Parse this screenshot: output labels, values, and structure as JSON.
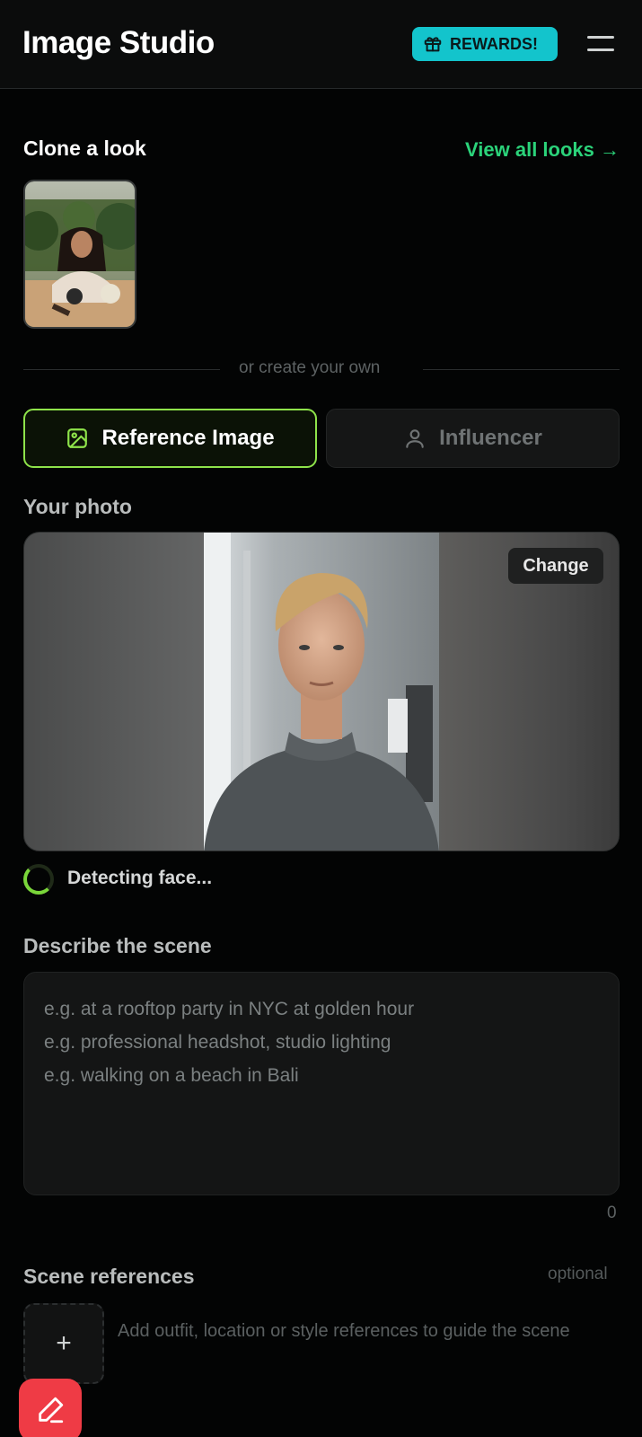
{
  "header": {
    "title": "Image Studio",
    "rewards_label": "REWARDS!",
    "accent": "#13c4cc"
  },
  "clone": {
    "title": "Clone a look",
    "view_all": "View all looks →",
    "link_color": "#2bd37a"
  },
  "divider": {
    "text": "or create your own"
  },
  "tabs": [
    {
      "label": "Reference Image",
      "icon": "image-icon",
      "active": true
    },
    {
      "label": "Influencer",
      "icon": "user-icon",
      "active": false
    }
  ],
  "photo": {
    "label": "Your photo",
    "change_label": "Change",
    "status": "Detecting face..."
  },
  "scene": {
    "label": "Describe the scene",
    "placeholder_lines": [
      "e.g. at a rooftop party in NYC at golden hour",
      "e.g. professional headshot, studio lighting",
      "e.g. walking on a beach in Bali"
    ],
    "char_count": "0"
  },
  "references": {
    "label": "Scene references",
    "optional": "optional",
    "add_symbol": "+",
    "hint": "Add outfit, location or style references to guide the scene"
  },
  "fab": {
    "icon": "edit-icon",
    "color": "#ef3b45"
  }
}
